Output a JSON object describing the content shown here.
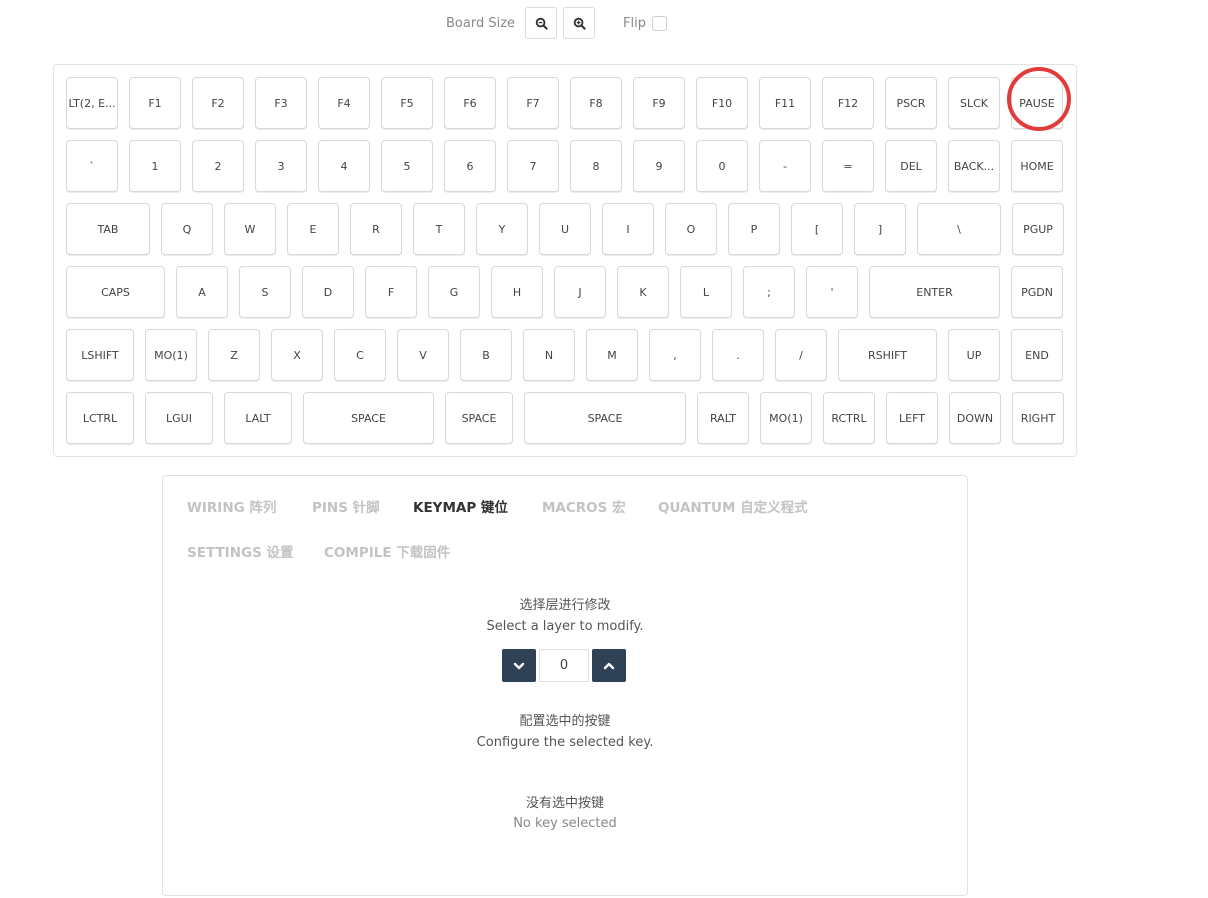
{
  "toolbar": {
    "board_size_label": "Board Size",
    "zoom_out_icon": "zoom-out-icon",
    "zoom_in_icon": "zoom-in-icon",
    "flip_label": "Flip",
    "flip_checked": false
  },
  "keyboard": {
    "rows": [
      [
        "LT(2, E...",
        "F1",
        "F2",
        "F3",
        "F4",
        "F5",
        "F6",
        "F7",
        "F8",
        "F9",
        "F10",
        "F11",
        "F12",
        "PSCR",
        "SLCK",
        "PAUSE"
      ],
      [
        "`",
        "1",
        "2",
        "3",
        "4",
        "5",
        "6",
        "7",
        "8",
        "9",
        "0",
        "-",
        "=",
        "DEL",
        "BACK...",
        "HOME"
      ],
      [
        "TAB",
        "Q",
        "W",
        "E",
        "R",
        "T",
        "Y",
        "U",
        "I",
        "O",
        "P",
        "[",
        "]",
        "\\",
        "PGUP"
      ],
      [
        "CAPS",
        "A",
        "S",
        "D",
        "F",
        "G",
        "H",
        "J",
        "K",
        "L",
        ";",
        "'",
        "ENTER",
        "PGDN"
      ],
      [
        "LSHIFT",
        "MO(1)",
        "Z",
        "X",
        "C",
        "V",
        "B",
        "N",
        "M",
        ",",
        ".",
        "/",
        "RSHIFT",
        "UP",
        "END"
      ],
      [
        "LCTRL",
        "LGUI",
        "LALT",
        "SPACE",
        "SPACE",
        "SPACE",
        "RALT",
        "MO(1)",
        "RCTRL",
        "LEFT",
        "DOWN",
        "RIGHT"
      ]
    ],
    "highlight_color": "#e23b3b"
  },
  "tabs": [
    {
      "label": "WIRING 阵列",
      "active": false
    },
    {
      "label": "PINS 针脚",
      "active": false
    },
    {
      "label": "KEYMAP 键位",
      "active": true
    },
    {
      "label": "MACROS 宏",
      "active": false
    },
    {
      "label": "QUANTUM 自定义程式",
      "active": false
    },
    {
      "label": "SETTINGS 设置",
      "active": false
    },
    {
      "label": "COMPILE 下载固件",
      "active": false
    }
  ],
  "layer": {
    "title_cn": "选择层进行修改",
    "title_en": "Select a layer to modify.",
    "value": "0"
  },
  "configure": {
    "title_cn": "配置选中的按键",
    "title_en": "Configure the selected key."
  },
  "selection": {
    "none_cn": "没有选中按键",
    "none_en": "No key selected"
  },
  "colors": {
    "accent": "#2f4155",
    "tab_inactive": "#c3c3c3",
    "tab_active": "#333333"
  }
}
